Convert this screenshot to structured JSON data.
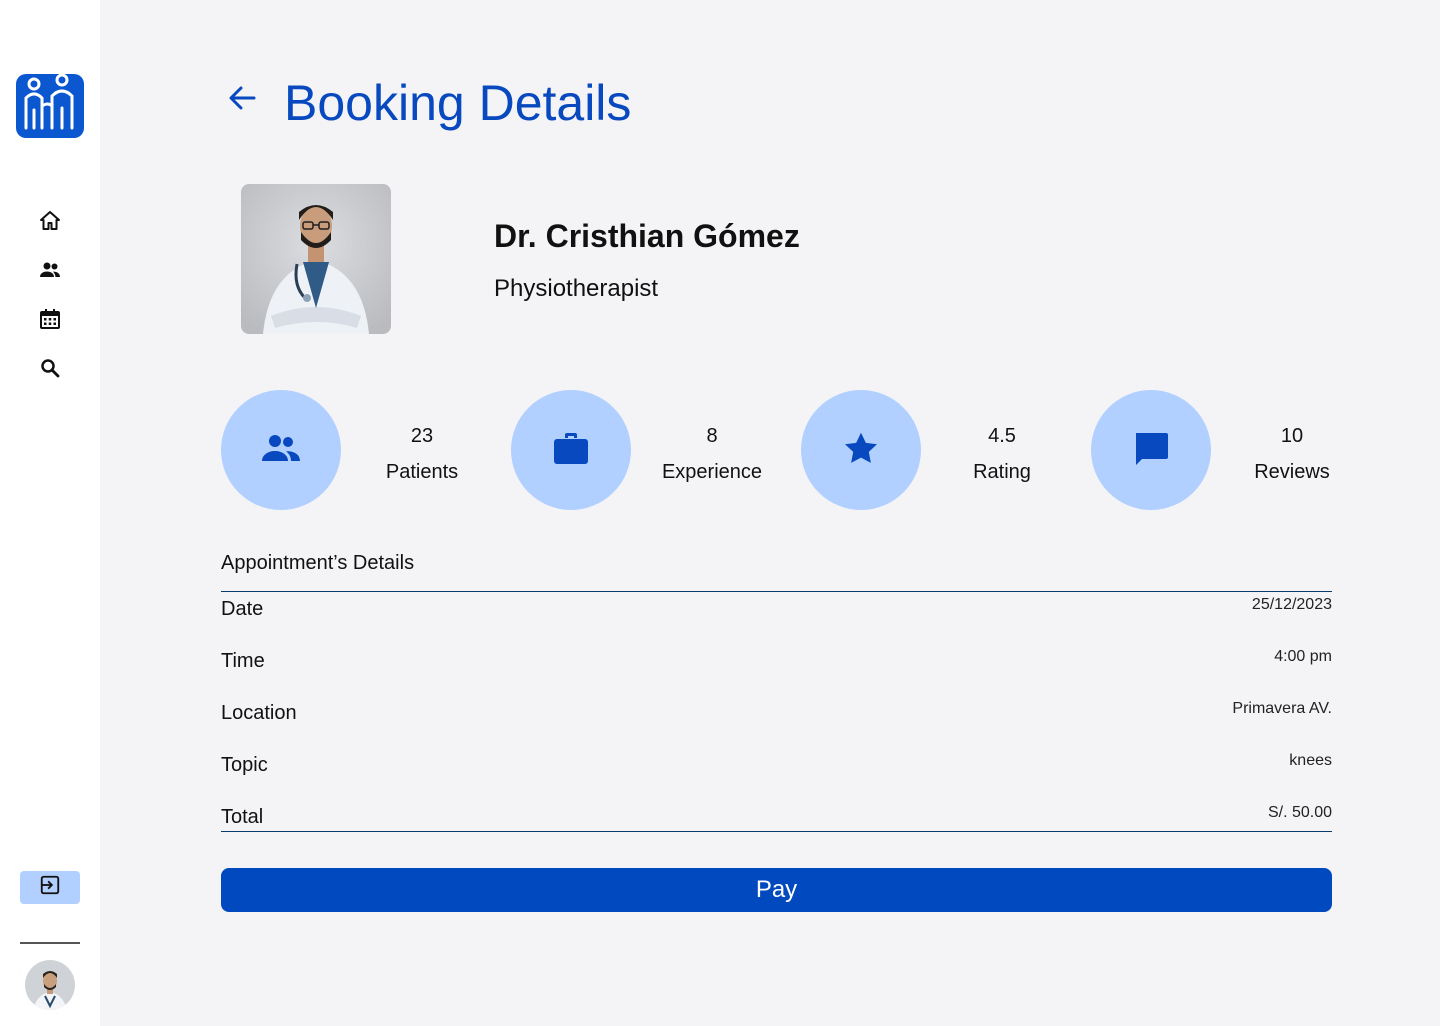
{
  "page": {
    "title": "Booking Details"
  },
  "doctor": {
    "name": "Dr. Cristhian Gómez",
    "specialty": "Physiotherapist"
  },
  "stats": [
    {
      "icon": "patients-icon",
      "value": "23",
      "label": "Patients"
    },
    {
      "icon": "briefcase-icon",
      "value": "8",
      "label": "Experience"
    },
    {
      "icon": "star-icon",
      "value": "4.5",
      "label": "Rating"
    },
    {
      "icon": "chat-icon",
      "value": "10",
      "label": "Reviews"
    }
  ],
  "appointment": {
    "heading": "Appointment’s Details",
    "rows": [
      {
        "label": "Date",
        "value": "25/12/2023"
      },
      {
        "label": "Time",
        "value": "4:00 pm"
      },
      {
        "label": "Location",
        "value": "Primavera AV."
      },
      {
        "label": "Topic",
        "value": "knees"
      },
      {
        "label": "Total",
        "value": "S/. 50.00"
      }
    ]
  },
  "actions": {
    "pay_label": "Pay"
  },
  "sidebar": {
    "items": [
      {
        "icon": "home-icon"
      },
      {
        "icon": "people-icon"
      },
      {
        "icon": "calendar-icon"
      },
      {
        "icon": "search-icon"
      }
    ],
    "logout_icon": "exit-icon"
  },
  "colors": {
    "primary": "#0049bf",
    "accent_light": "#b1d0ff",
    "background": "#f4f4f7"
  }
}
